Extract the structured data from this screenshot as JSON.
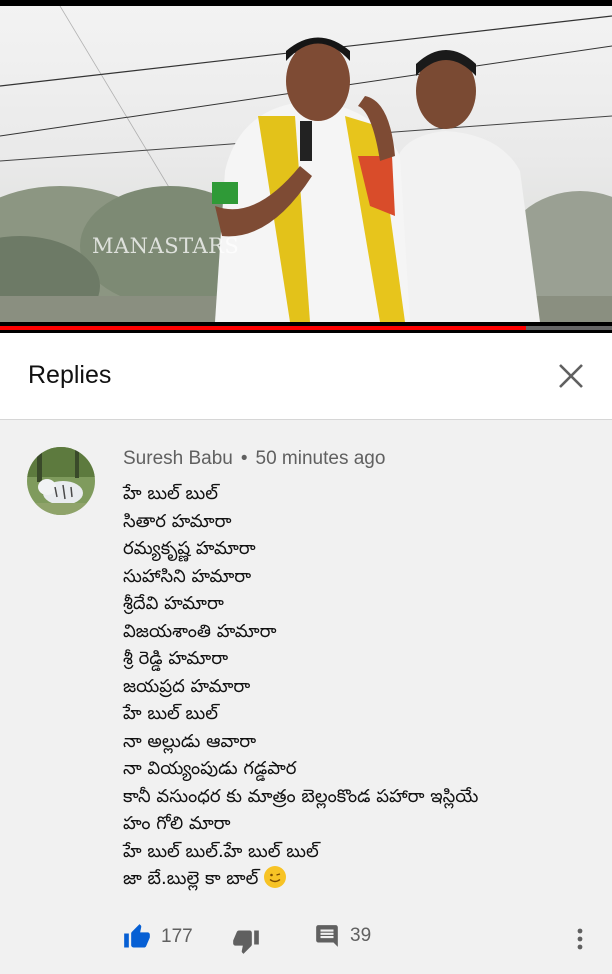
{
  "video": {
    "watermark": "MANASTARS",
    "progress": 0.86,
    "progress_color": "#ff0000"
  },
  "header": {
    "title": "Replies",
    "close_icon": "close-icon"
  },
  "comment": {
    "author": "Suresh Babu",
    "separator": "•",
    "time": "50 minutes ago",
    "avatar_icon": "white-tiger-avatar",
    "lines": [
      "హే బుల్ బుల్",
      "సితార హమారా",
      "రమ్యకృష్ణ హమారా",
      "సుహాసిని  హమారా",
      "శ్రీదేవి హమారా",
      "విజయశాంతి హమారా",
      "శ్రీ రెడ్డి హమారా",
      "జయప్రద హమారా",
      "హే బుల్ బుల్",
      "నా అల్లుడు ఆవారా",
      "నా వియ్యంపుడు గడ్డపార",
      "కానీ వసుంధర కు మాత్రం బెల్లంకొండ పహారా ఇస్లియే",
      "హం గోలి మారా",
      "హే బుల్ బుల్.హే బుల్ బుల్",
      "జా బే.బుల్లె కా బాల్"
    ],
    "emoji_icon": "smiling-face-emoji",
    "likes": "177",
    "replies": "39",
    "like_icon": "thumbs-up-icon",
    "dislike_icon": "thumbs-down-icon",
    "reply_icon": "comment-icon",
    "more_icon": "more-vertical-icon",
    "accent_color": "#065fd4"
  }
}
